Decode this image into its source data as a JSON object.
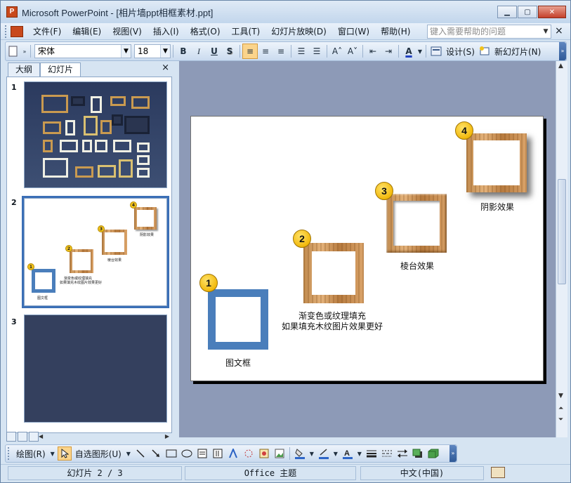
{
  "window": {
    "title": "Microsoft PowerPoint - [相片墙ppt相框素材.ppt]",
    "app_icon": "powerpoint-icon",
    "buttons": {
      "minimize": "▁",
      "maximize": "▢",
      "close": "✕"
    }
  },
  "menu": {
    "items": [
      "文件(F)",
      "编辑(E)",
      "视图(V)",
      "插入(I)",
      "格式(O)",
      "工具(T)",
      "幻灯片放映(D)",
      "窗口(W)",
      "帮助(H)"
    ],
    "help_placeholder": "键入需要帮助的问题",
    "doc_close": "×"
  },
  "toolbar": {
    "font": "宋体",
    "size": "18",
    "bold": "B",
    "italic": "I",
    "underline": "U",
    "shadow": "S",
    "align_left": "≡",
    "align_center": "≡",
    "align_right": "≡",
    "numbering": "☰",
    "bullets": "☰",
    "grow_font": "A˄",
    "shrink_font": "A˅",
    "decrease_indent": "⇤",
    "increase_indent": "⇥",
    "font_color": "A",
    "design_label": "设计(S)",
    "new_slide_label": "新幻灯片(N)"
  },
  "left_panel": {
    "tabs": [
      "大纲",
      "幻灯片"
    ],
    "active_tab": "幻灯片",
    "close": "×",
    "slides": [
      {
        "number": "1"
      },
      {
        "number": "2"
      },
      {
        "number": "3"
      }
    ],
    "thumb2": {
      "badges": [
        "1",
        "2",
        "3",
        "4"
      ]
    }
  },
  "slide": {
    "items": [
      {
        "badge": "1",
        "caption_lines": [
          "图文框"
        ]
      },
      {
        "badge": "2",
        "caption_lines": [
          "渐变色或纹理填充",
          "如果填充木纹图片效果更好"
        ]
      },
      {
        "badge": "3",
        "caption_lines": [
          "棱台效果"
        ]
      },
      {
        "badge": "4",
        "caption_lines": [
          "阴影效果"
        ]
      }
    ]
  },
  "drawbar": {
    "draw_label": "绘图(R)",
    "autoshapes_label": "自选图形(U)"
  },
  "status": {
    "slide_indicator": "幻灯片 2 / 3",
    "theme": "Office 主题",
    "language": "中文(中国)"
  },
  "colors": {
    "blue_frame": "#4a7ebb",
    "badge": "#f2b90c",
    "wood": "#c08a4e",
    "selection": "#3b6fb6"
  }
}
